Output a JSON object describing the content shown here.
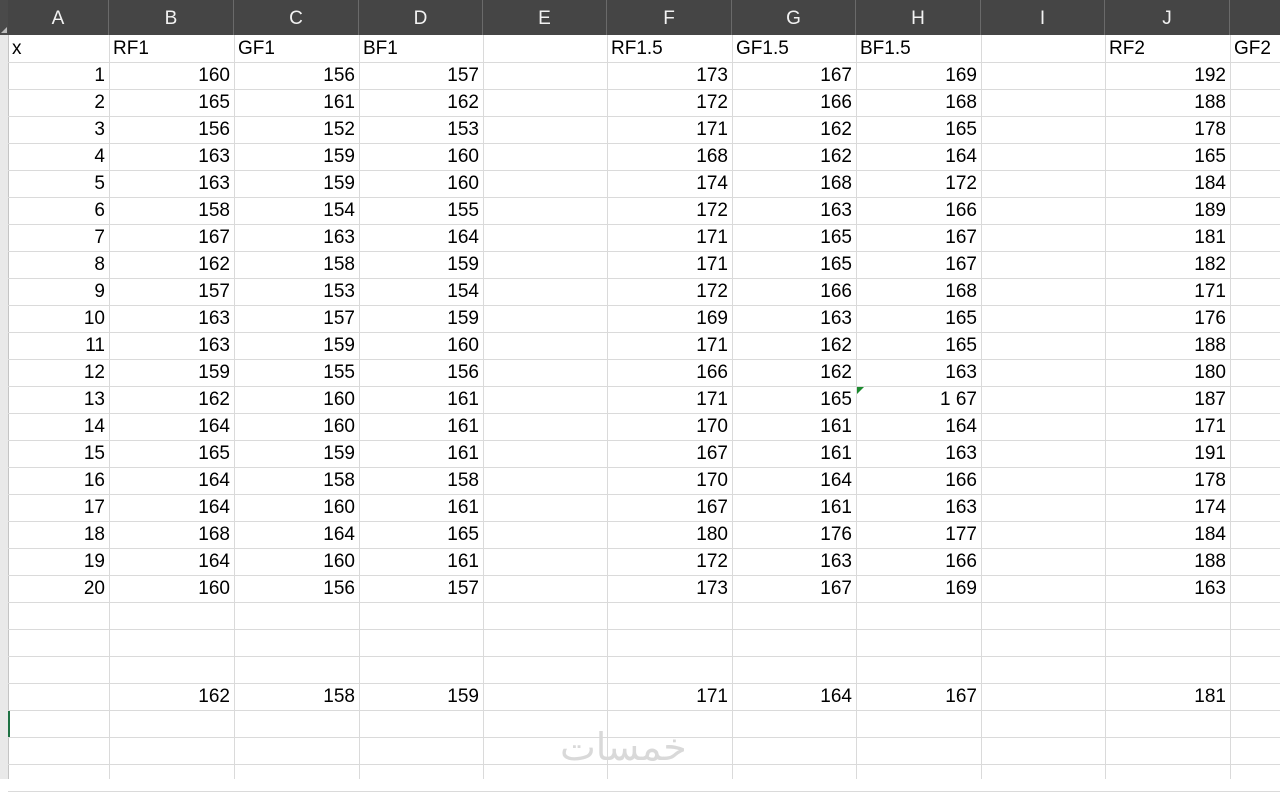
{
  "columns": [
    "A",
    "B",
    "C",
    "D",
    "E",
    "F",
    "G",
    "H",
    "I",
    "J",
    ""
  ],
  "headers": [
    "x",
    "RF1",
    "GF1",
    "BF1",
    "",
    "RF1.5",
    "GF1.5",
    "BF1.5",
    "",
    "RF2",
    "GF2"
  ],
  "rows": [
    [
      "1",
      "160",
      "156",
      "157",
      "",
      "173",
      "167",
      "169",
      "",
      "192"
    ],
    [
      "2",
      "165",
      "161",
      "162",
      "",
      "172",
      "166",
      "168",
      "",
      "188"
    ],
    [
      "3",
      "156",
      "152",
      "153",
      "",
      "171",
      "162",
      "165",
      "",
      "178"
    ],
    [
      "4",
      "163",
      "159",
      "160",
      "",
      "168",
      "162",
      "164",
      "",
      "165"
    ],
    [
      "5",
      "163",
      "159",
      "160",
      "",
      "174",
      "168",
      "172",
      "",
      "184"
    ],
    [
      "6",
      "158",
      "154",
      "155",
      "",
      "172",
      "163",
      "166",
      "",
      "189"
    ],
    [
      "7",
      "167",
      "163",
      "164",
      "",
      "171",
      "165",
      "167",
      "",
      "181"
    ],
    [
      "8",
      "162",
      "158",
      "159",
      "",
      "171",
      "165",
      "167",
      "",
      "182"
    ],
    [
      "9",
      "157",
      "153",
      "154",
      "",
      "172",
      "166",
      "168",
      "",
      "171"
    ],
    [
      "10",
      "163",
      "157",
      "159",
      "",
      "169",
      "163",
      "165",
      "",
      "176"
    ],
    [
      "11",
      "163",
      "159",
      "160",
      "",
      "171",
      "162",
      "165",
      "",
      "188"
    ],
    [
      "12",
      "159",
      "155",
      "156",
      "",
      "166",
      "162",
      "163",
      "",
      "180"
    ],
    [
      "13",
      "162",
      "160",
      "161",
      "",
      "171",
      "165",
      "1 67",
      "",
      "187"
    ],
    [
      "14",
      "164",
      "160",
      "161",
      "",
      "170",
      "161",
      "164",
      "",
      "171"
    ],
    [
      "15",
      "165",
      "159",
      "161",
      "",
      "167",
      "161",
      "163",
      "",
      "191"
    ],
    [
      "16",
      "164",
      "158",
      "158",
      "",
      "170",
      "164",
      "166",
      "",
      "178"
    ],
    [
      "17",
      "164",
      "160",
      "161",
      "",
      "167",
      "161",
      "163",
      "",
      "174"
    ],
    [
      "18",
      "168",
      "164",
      "165",
      "",
      "180",
      "176",
      "177",
      "",
      "184"
    ],
    [
      "19",
      "164",
      "160",
      "161",
      "",
      "172",
      "163",
      "166",
      "",
      "188"
    ],
    [
      "20",
      "160",
      "156",
      "157",
      "",
      "173",
      "167",
      "169",
      "",
      "163"
    ]
  ],
  "averages": [
    "",
    "162",
    "158",
    "159",
    "",
    "171",
    "164",
    "167",
    "",
    "181"
  ],
  "watermark": "خمسات",
  "colors": {
    "header_bg": "#454545",
    "gridline": "#dadada",
    "error_indicator": "#1b8a2e"
  }
}
